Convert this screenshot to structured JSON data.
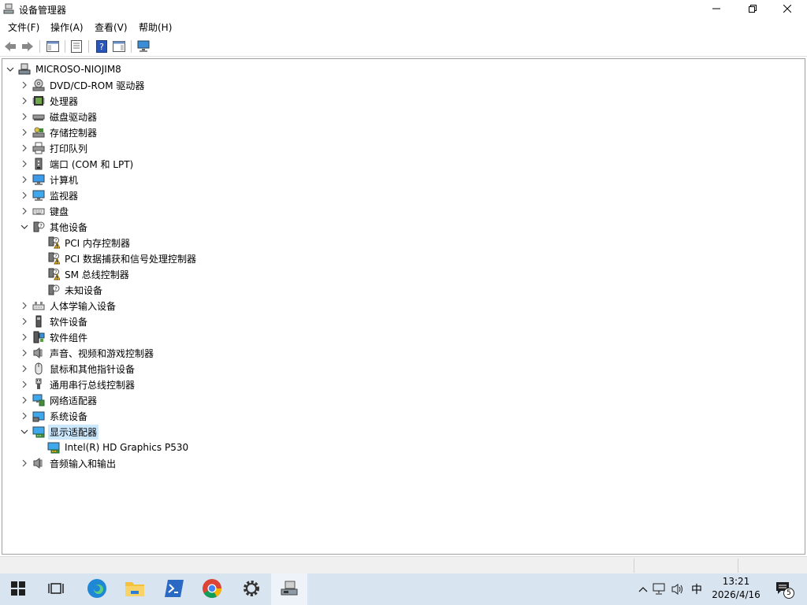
{
  "window": {
    "title": "设备管理器"
  },
  "menu": [
    "文件(F)",
    "操作(A)",
    "查看(V)",
    "帮助(H)"
  ],
  "tree": {
    "root": "MICROSO-NIOJIM8",
    "items": [
      {
        "label": "DVD/CD-ROM 驱动器",
        "icon": "dvd-drive-icon"
      },
      {
        "label": "处理器",
        "icon": "processor-icon"
      },
      {
        "label": "磁盘驱动器",
        "icon": "disk-drive-icon"
      },
      {
        "label": "存储控制器",
        "icon": "storage-controller-icon"
      },
      {
        "label": "打印队列",
        "icon": "printer-icon"
      },
      {
        "label": "端口 (COM 和 LPT)",
        "icon": "port-icon"
      },
      {
        "label": "计算机",
        "icon": "computer-icon"
      },
      {
        "label": "监视器",
        "icon": "monitor-icon"
      },
      {
        "label": "键盘",
        "icon": "keyboard-icon"
      },
      {
        "label": "其他设备",
        "icon": "unknown-device-icon",
        "expanded": true,
        "children": [
          {
            "label": "PCI 内存控制器",
            "icon": "warning-device-icon"
          },
          {
            "label": "PCI 数据捕获和信号处理控制器",
            "icon": "warning-device-icon"
          },
          {
            "label": "SM 总线控制器",
            "icon": "warning-device-icon"
          },
          {
            "label": "未知设备",
            "icon": "unknown-device-icon"
          }
        ]
      },
      {
        "label": "人体学输入设备",
        "icon": "hid-icon"
      },
      {
        "label": "软件设备",
        "icon": "software-device-icon"
      },
      {
        "label": "软件组件",
        "icon": "software-component-icon"
      },
      {
        "label": "声音、视频和游戏控制器",
        "icon": "speaker-icon"
      },
      {
        "label": "鼠标和其他指针设备",
        "icon": "mouse-icon"
      },
      {
        "label": "通用串行总线控制器",
        "icon": "usb-icon"
      },
      {
        "label": "网络适配器",
        "icon": "network-adapter-icon"
      },
      {
        "label": "系统设备",
        "icon": "system-device-icon"
      },
      {
        "label": "显示适配器",
        "icon": "display-adapter-icon",
        "expanded": true,
        "selected": true,
        "children": [
          {
            "label": "Intel(R) HD Graphics P530",
            "icon": "display-adapter-icon"
          }
        ]
      },
      {
        "label": "音频输入和输出",
        "icon": "speaker-icon"
      }
    ]
  },
  "taskbar": {
    "apps": [
      "start-icon",
      "task-view-icon",
      "edge-icon",
      "file-explorer-icon",
      "powershell-icon",
      "chrome-icon",
      "settings-icon",
      "device-manager-icon"
    ],
    "tray": {
      "ime": "中",
      "time": "13:21",
      "date": "2026/4/16",
      "notifications": "5"
    }
  }
}
